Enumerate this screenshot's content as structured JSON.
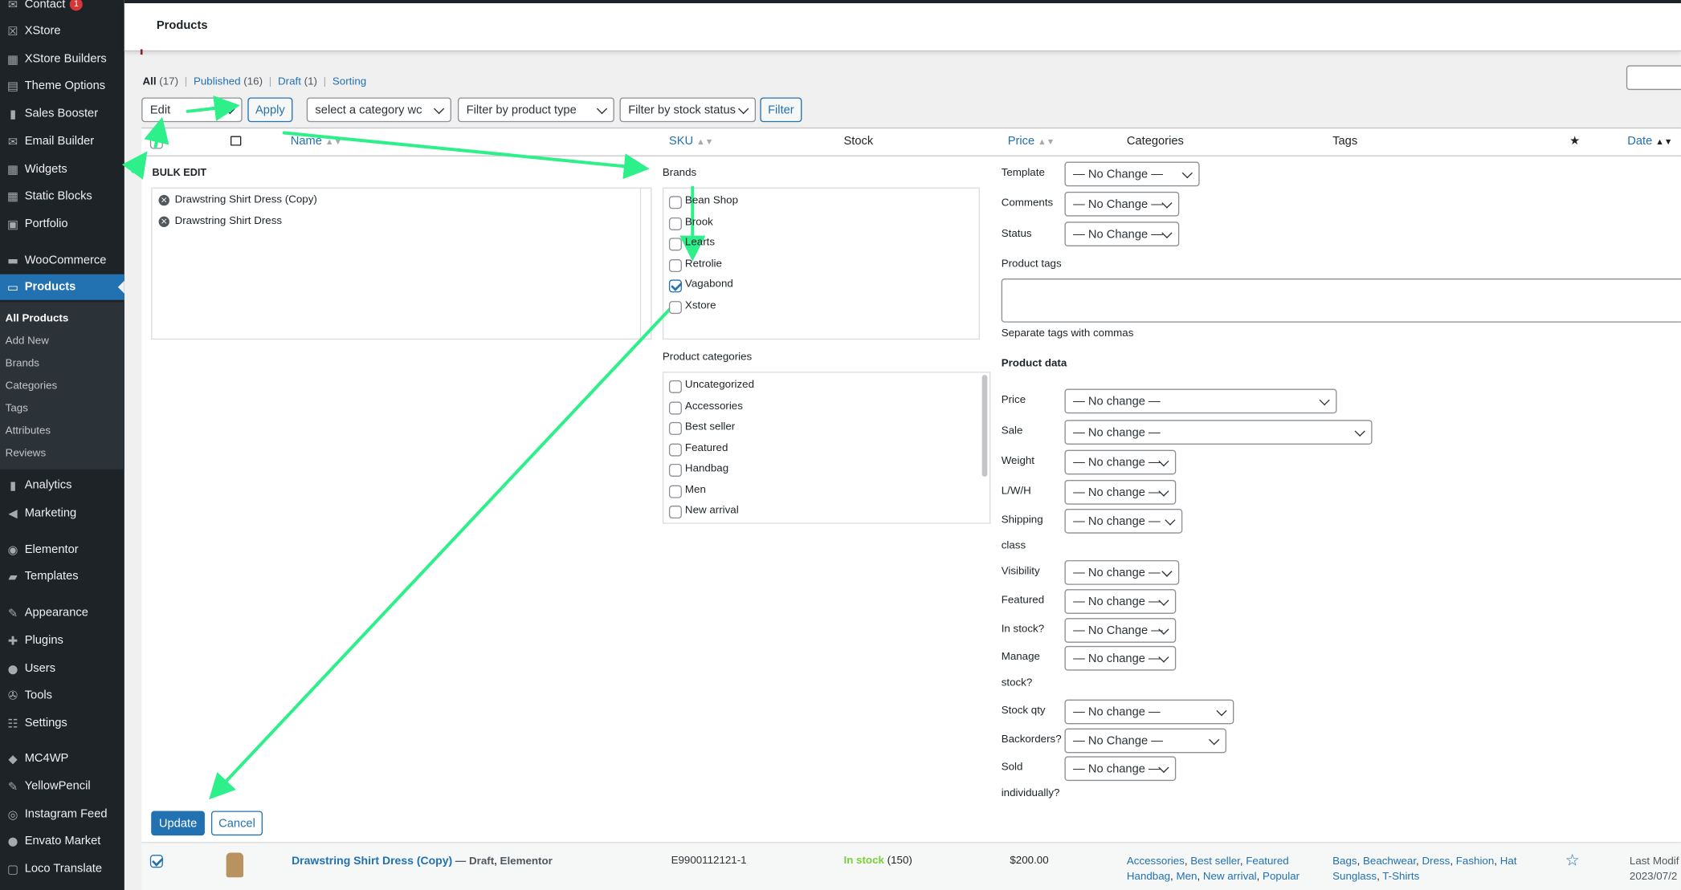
{
  "sidebar": {
    "items": [
      {
        "label": "Contact",
        "icon": "mail-icon",
        "badge": "1"
      },
      {
        "label": "XStore",
        "icon": "xstore-icon"
      },
      {
        "label": "XStore Builders",
        "icon": "builders-icon"
      },
      {
        "label": "Theme Options",
        "icon": "options-icon"
      },
      {
        "label": "Sales Booster",
        "icon": "chart-icon"
      },
      {
        "label": "Email Builder",
        "icon": "mail-icon"
      },
      {
        "label": "Widgets",
        "icon": "widgets-icon"
      },
      {
        "label": "Static Blocks",
        "icon": "blocks-icon"
      },
      {
        "label": "Portfolio",
        "icon": "portfolio-icon"
      },
      {
        "label": "WooCommerce",
        "icon": "woo-icon"
      },
      {
        "label": "Products",
        "icon": "products-icon"
      },
      {
        "label": "Analytics",
        "icon": "analytics-icon"
      },
      {
        "label": "Marketing",
        "icon": "megaphone-icon"
      },
      {
        "label": "Elementor",
        "icon": "elementor-icon"
      },
      {
        "label": "Templates",
        "icon": "folder-icon"
      },
      {
        "label": "Appearance",
        "icon": "brush-icon"
      },
      {
        "label": "Plugins",
        "icon": "plugin-icon"
      },
      {
        "label": "Users",
        "icon": "users-icon"
      },
      {
        "label": "Tools",
        "icon": "wrench-icon"
      },
      {
        "label": "Settings",
        "icon": "settings-icon"
      },
      {
        "label": "MC4WP",
        "icon": "mc4wp-icon"
      },
      {
        "label": "YellowPencil",
        "icon": "pencil-icon"
      },
      {
        "label": "Instagram Feed",
        "icon": "instagram-icon"
      },
      {
        "label": "Envato Market",
        "icon": "envato-icon"
      },
      {
        "label": "Loco Translate",
        "icon": "translate-icon"
      }
    ],
    "submenu": [
      "All Products",
      "Add New",
      "Brands",
      "Categories",
      "Tags",
      "Attributes",
      "Reviews"
    ]
  },
  "header": {
    "title": "Products"
  },
  "views": {
    "all": "All",
    "all_count": "(17)",
    "published": "Published",
    "published_count": "(16)",
    "draft": "Draft",
    "draft_count": "(1)",
    "sorting": "Sorting",
    "separator": "|"
  },
  "filters": {
    "bulk_action": "Edit",
    "apply": "Apply",
    "category": "select a category wc",
    "product_type": "Filter by product type",
    "stock_status": "Filter by stock status",
    "filter": "Filter"
  },
  "columns": {
    "name": "Name",
    "sku": "SKU",
    "stock": "Stock",
    "price": "Price",
    "categories": "Categories",
    "tags": "Tags",
    "date": "Date"
  },
  "bulk_edit": {
    "title": "BULK EDIT",
    "products": [
      "Drawstring Shirt Dress (Copy)",
      "Drawstring Shirt Dress"
    ],
    "brands_label": "Brands",
    "brands": [
      {
        "label": "Bean Shop",
        "checked": false
      },
      {
        "label": "Brook",
        "checked": false
      },
      {
        "label": "Learts",
        "checked": false
      },
      {
        "label": "Retrolie",
        "checked": false
      },
      {
        "label": "Vagabond",
        "checked": true
      },
      {
        "label": "Xstore",
        "checked": false
      }
    ],
    "categories_label": "Product categories",
    "categories": [
      "Uncategorized",
      "Accessories",
      "Best seller",
      "Featured",
      "Handbag",
      "Men",
      "New arrival"
    ],
    "template_label": "Template",
    "template_value": "— No Change —",
    "comments_label": "Comments",
    "comments_value": "— No Change —",
    "status_label": "Status",
    "status_value": "— No Change —",
    "tags_label": "Product tags",
    "tags_hint": "Separate tags with commas",
    "product_data_label": "Product data",
    "fields": [
      {
        "label": "Price",
        "value": "— No change —"
      },
      {
        "label": "Sale",
        "value": "— No change —"
      },
      {
        "label": "Weight",
        "value": "— No change —"
      },
      {
        "label": "L/W/H",
        "value": "— No change —"
      },
      {
        "label": "Shipping",
        "label2": "class",
        "value": "— No change —"
      },
      {
        "label": "Visibility",
        "value": "— No change —"
      },
      {
        "label": "Featured",
        "value": "— No change —"
      },
      {
        "label": "In stock?",
        "value": "— No Change —"
      },
      {
        "label": "Manage",
        "label2": "stock?",
        "value": "— No change —"
      },
      {
        "label": "Stock qty",
        "value": "— No change —"
      },
      {
        "label": "Backorders?",
        "value": "— No Change —"
      },
      {
        "label": "Sold",
        "label2": "individually?",
        "value": "— No change —"
      }
    ],
    "update": "Update",
    "cancel": "Cancel"
  },
  "product_row": {
    "name": "Drawstring Shirt Dress (Copy)",
    "state": "— Draft, Elementor",
    "sku": "E9900112121-1",
    "stock": "In stock",
    "stock_qty": "(150)",
    "price": "$200.00",
    "categories_line1": [
      "Accessories",
      "Best seller",
      "Featured"
    ],
    "categories_line2": [
      "Handbag",
      "Men",
      "New arrival",
      "Popular"
    ],
    "tags_line1": [
      "Bags",
      "Beachwear",
      "Dress",
      "Fashion",
      "Hat"
    ],
    "tags_line2": [
      "Sunglass",
      "T-Shirts"
    ],
    "date_line1": "Last Modif",
    "date_line2": "2023/07/2"
  },
  "colors": {
    "accent": "#2271b1",
    "arrow": "#2ef08a",
    "sidebar": "#1d2327",
    "instock": "#7ad03a"
  }
}
